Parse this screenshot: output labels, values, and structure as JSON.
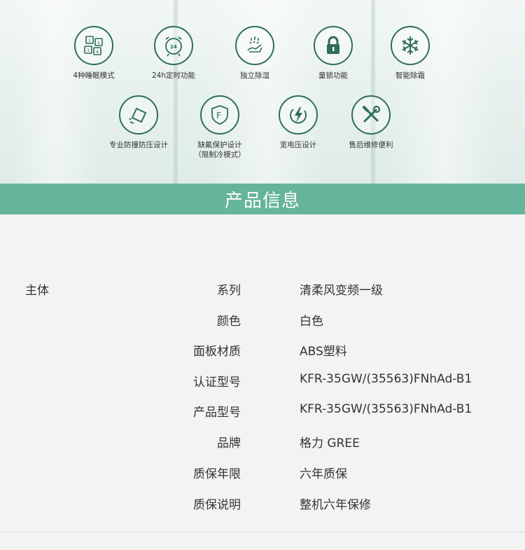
{
  "features": [
    {
      "icon": "sleep-modes-icon",
      "label": "4种睡眠模式"
    },
    {
      "icon": "alarm-clock-icon",
      "label": "24h定时功能"
    },
    {
      "icon": "dehumidify-icon",
      "label": "独立除湿"
    },
    {
      "icon": "lock-icon",
      "label": "童锁功能"
    },
    {
      "icon": "snowflake-icon",
      "label": "智能除霜"
    },
    {
      "icon": "anti-pressure-icon",
      "label": "专业防撞防压设计"
    },
    {
      "icon": "refrigerant-shield-icon",
      "label": "缺氟保护设计\n（限制冷模式）"
    },
    {
      "icon": "lightning-icon",
      "label": "宽电压设计"
    },
    {
      "icon": "repair-tools-icon",
      "label": "售后维修便利"
    }
  ],
  "icon_ring_text": "24",
  "shield_letter": "F",
  "banner_title": "产品信息",
  "colors": {
    "accent": "#65b49c",
    "icon_stroke": "#2f6e58"
  },
  "spec_group": "主体",
  "specs": [
    {
      "key": "系列",
      "value": "清柔风变频一级"
    },
    {
      "key": "颜色",
      "value": "白色"
    },
    {
      "key": "面板材质",
      "value": "ABS塑料"
    },
    {
      "key": "认证型号",
      "value": "KFR-35GW/(35563)FNhAd-B1"
    },
    {
      "key": "产品型号",
      "value": "KFR-35GW/(35563)FNhAd-B1"
    },
    {
      "key": "品牌",
      "value": "格力 GREE"
    },
    {
      "key": "质保年限",
      "value": "六年质保"
    },
    {
      "key": "质保说明",
      "value": "整机六年保修"
    }
  ]
}
